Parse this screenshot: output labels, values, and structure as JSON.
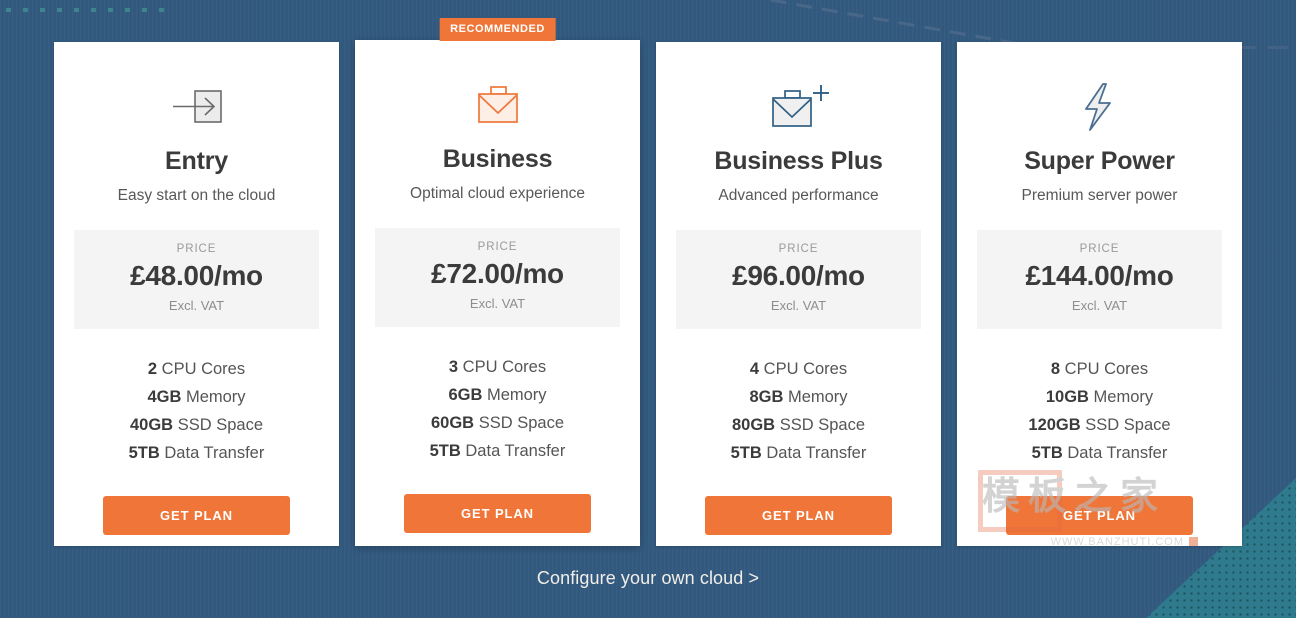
{
  "background": {
    "color": "#335a80",
    "accent_teal": "#2f7a8c"
  },
  "theme": {
    "accent_orange": "#ef7638",
    "card_background": "#ffffff",
    "price_box_background": "#f4f4f4",
    "heading_color": "#3b3b3b"
  },
  "plans": [
    {
      "id": "entry",
      "icon": "arrow-into-box-icon",
      "icon_color": "#6b6b6b",
      "name": "Entry",
      "tagline": "Easy start on the cloud",
      "price_label": "PRICE",
      "price": "£48.00/mo",
      "price_note": "Excl. VAT",
      "specs": [
        {
          "value": "2",
          "label": "CPU Cores"
        },
        {
          "value": "4GB",
          "label": "Memory"
        },
        {
          "value": "40GB",
          "label": "SSD Space"
        },
        {
          "value": "5TB",
          "label": "Data Transfer"
        }
      ],
      "cta_label": "GET PLAN",
      "recommended": false,
      "badge_label": ""
    },
    {
      "id": "business",
      "icon": "briefcase-icon",
      "icon_color": "#ef7638",
      "name": "Business",
      "tagline": "Optimal cloud experience",
      "price_label": "PRICE",
      "price": "£72.00/mo",
      "price_note": "Excl. VAT",
      "specs": [
        {
          "value": "3",
          "label": "CPU Cores"
        },
        {
          "value": "6GB",
          "label": "Memory"
        },
        {
          "value": "60GB",
          "label": "SSD Space"
        },
        {
          "value": "5TB",
          "label": "Data Transfer"
        }
      ],
      "cta_label": "GET PLAN",
      "recommended": true,
      "badge_label": "RECOMMENDED"
    },
    {
      "id": "business-plus",
      "icon": "briefcase-plus-icon",
      "icon_color": "#2f5f84",
      "name": "Business Plus",
      "tagline": "Advanced performance",
      "price_label": "PRICE",
      "price": "£96.00/mo",
      "price_note": "Excl. VAT",
      "specs": [
        {
          "value": "4",
          "label": "CPU Cores"
        },
        {
          "value": "8GB",
          "label": "Memory"
        },
        {
          "value": "80GB",
          "label": "SSD Space"
        },
        {
          "value": "5TB",
          "label": "Data Transfer"
        }
      ],
      "cta_label": "GET PLAN",
      "recommended": false,
      "badge_label": ""
    },
    {
      "id": "super-power",
      "icon": "lightning-bolt-icon",
      "icon_color": "#4a6f93",
      "name": "Super Power",
      "tagline": "Premium server power",
      "price_label": "PRICE",
      "price": "£144.00/mo",
      "price_note": "Excl. VAT",
      "specs": [
        {
          "value": "8",
          "label": "CPU Cores"
        },
        {
          "value": "10GB",
          "label": "Memory"
        },
        {
          "value": "120GB",
          "label": "SSD Space"
        },
        {
          "value": "5TB",
          "label": "Data Transfer"
        }
      ],
      "cta_label": "GET PLAN",
      "recommended": false,
      "badge_label": ""
    }
  ],
  "footer": {
    "configure_link": "Configure your own cloud >"
  },
  "watermark": {
    "chinese_text": "模板之家",
    "url": "WWW.BANZHUTI.COM"
  }
}
